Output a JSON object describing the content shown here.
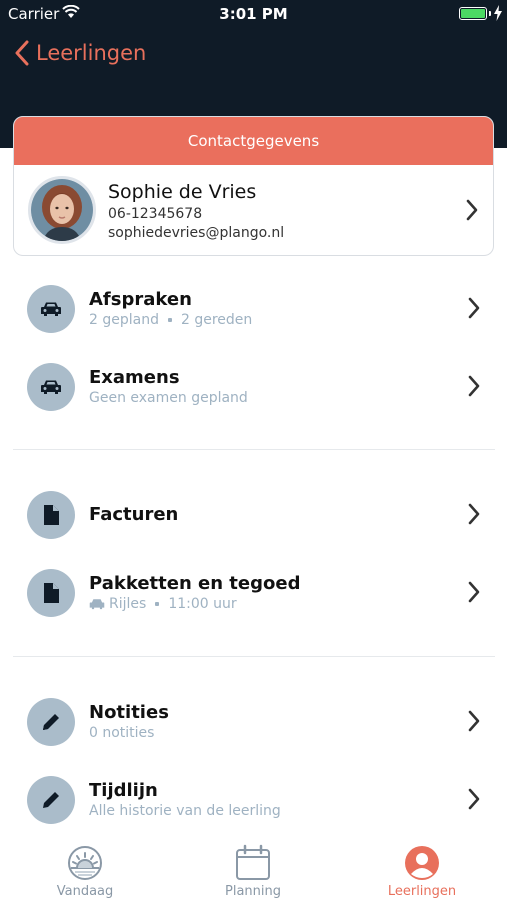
{
  "status_bar": {
    "carrier": "Carrier",
    "time": "3:01 PM",
    "icons": [
      "wifi-icon",
      "battery-icon",
      "charging-icon"
    ]
  },
  "nav": {
    "back_label": "Leerlingen",
    "back_icon": "chevron-left-icon"
  },
  "contact_card": {
    "header": "Contactgegevens",
    "name": "Sophie de Vries",
    "phone": "06-12345678",
    "email": "sophiedevries@plango.nl"
  },
  "sections": {
    "afspraken": {
      "title": "Afspraken",
      "icon": "car-icon",
      "planned": "2 gepland",
      "driven": "2 gereden"
    },
    "examens": {
      "title": "Examens",
      "icon": "car-icon",
      "subtitle": "Geen examen gepland"
    },
    "facturen": {
      "title": "Facturen",
      "icon": "document-icon"
    },
    "pakketten": {
      "title": "Pakketten en tegoed",
      "icon": "document-icon",
      "lesson_type": "Rijles",
      "duration": "11:00 uur"
    },
    "notities": {
      "title": "Notities",
      "icon": "pencil-icon",
      "subtitle": "0 notities"
    },
    "tijdlijn": {
      "title": "Tijdlijn",
      "icon": "pencil-icon",
      "subtitle": "Alle historie van de leerling"
    }
  },
  "tabbar": {
    "tabs": [
      {
        "label": "Vandaag",
        "icon": "sunrise-icon",
        "active": false
      },
      {
        "label": "Planning",
        "icon": "calendar-icon",
        "active": false
      },
      {
        "label": "Leerlingen",
        "icon": "user-icon",
        "active": true
      }
    ]
  },
  "colors": {
    "accent": "#e8705c",
    "header_bg": "#0f1b27",
    "icon_circle": "#aabcca",
    "muted_text": "#9fb2c2"
  }
}
